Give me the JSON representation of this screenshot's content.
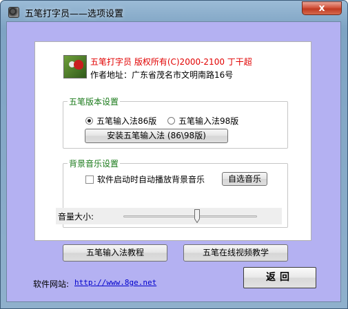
{
  "window": {
    "title": "五笔打字员——选项设置",
    "close_label": "x"
  },
  "header": {
    "copyright": "五笔打字员 版权所有(C)2000-2100 丁干超",
    "address": "作者地址：广东省茂名市文明南路16号"
  },
  "version_group": {
    "title": "五笔版本设置",
    "option_86": "五笔输入法86版",
    "option_98": "五笔输入法98版",
    "selected": "86",
    "install_label": "安装五笔输入法 (86\\98版)"
  },
  "music_group": {
    "title": "背景音乐设置",
    "autoplay_label": "软件启动时自动播放背景音乐",
    "autoplay_checked": false,
    "choose_music_label": "自选音乐",
    "volume_label": "音量大小:",
    "volume_level": 0.55
  },
  "buttons": {
    "tutorial_label": "五笔输入法教程",
    "video_label": "五笔在线视频教学",
    "back_label": "返回"
  },
  "footer": {
    "website_label": "软件网站:",
    "website_url": "http://www.8ge.net"
  },
  "colors": {
    "client_bg": "#b4b1f2",
    "copyright_text": "#e10000",
    "group_title": "#1a7a1a",
    "link": "#0000cc"
  }
}
